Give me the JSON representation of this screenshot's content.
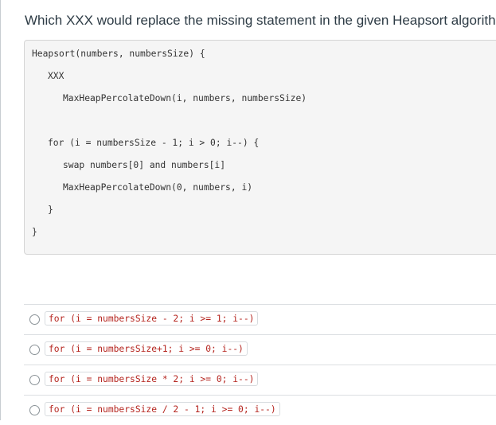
{
  "question": {
    "text": "Which XXX would replace the missing statement in the given Heapsort algorithm?"
  },
  "code": {
    "lines": [
      "Heapsort(numbers, numbersSize) {",
      "XXX",
      "MaxHeapPercolateDown(i, numbers, numbersSize)",
      "for (i = numbersSize - 1; i > 0; i--) {",
      "swap numbers[0] and numbers[i]",
      "MaxHeapPercolateDown(0, numbers, i)",
      "}",
      "}"
    ]
  },
  "answers": [
    {
      "code": "for (i = numbersSize - 2; i >= 1; i--)"
    },
    {
      "code": "for (i = numbersSize+1; i >= 0; i--)"
    },
    {
      "code": "for (i = numbersSize * 2; i >= 0; i--)"
    },
    {
      "code": "for (i = numbersSize / 2 - 1; i >= 0; i--)"
    }
  ],
  "colors": {
    "answer_code_text": "#b5251f",
    "code_background": "#f5f5f5",
    "divider": "#dcdfe2"
  }
}
